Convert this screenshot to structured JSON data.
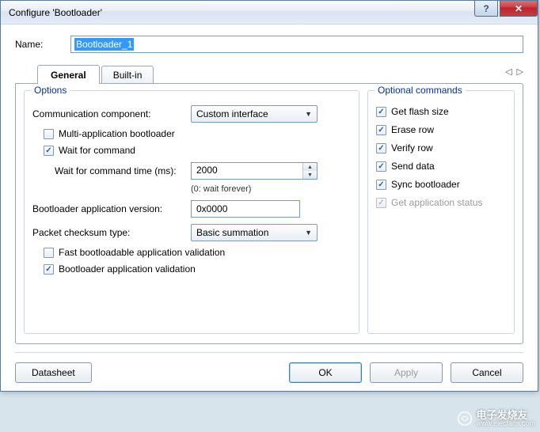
{
  "titlebar": {
    "title": "Configure 'Bootloader'",
    "help": "?",
    "close": "✕"
  },
  "name": {
    "label": "Name:",
    "value": "Bootloader_1"
  },
  "tabs": {
    "general": "General",
    "builtin": "Built-in",
    "prev": "◁",
    "next": "▷"
  },
  "options": {
    "legend": "Options",
    "comm_component_label": "Communication component:",
    "comm_component_value": "Custom interface",
    "multi_app": "Multi-application bootloader",
    "wait_cmd": "Wait for command",
    "wait_time_label": "Wait for command time (ms):",
    "wait_time_value": "2000",
    "wait_hint": "(0: wait forever)",
    "app_version_label": "Bootloader application version:",
    "app_version_value": "0x0000",
    "checksum_label": "Packet checksum type:",
    "checksum_value": "Basic summation",
    "fast_validation": "Fast bootloadable application validation",
    "bootloader_validation": "Bootloader application validation"
  },
  "optional": {
    "legend": "Optional commands",
    "get_flash": "Get flash size",
    "erase_row": "Erase row",
    "verify_row": "Verify row",
    "send_data": "Send data",
    "sync_boot": "Sync bootloader",
    "get_app_status": "Get application status"
  },
  "buttons": {
    "datasheet": "Datasheet",
    "ok": "OK",
    "apply": "Apply",
    "cancel": "Cancel"
  },
  "watermark": {
    "cn": "电子发烧友",
    "url": "www.elecfans.com"
  }
}
